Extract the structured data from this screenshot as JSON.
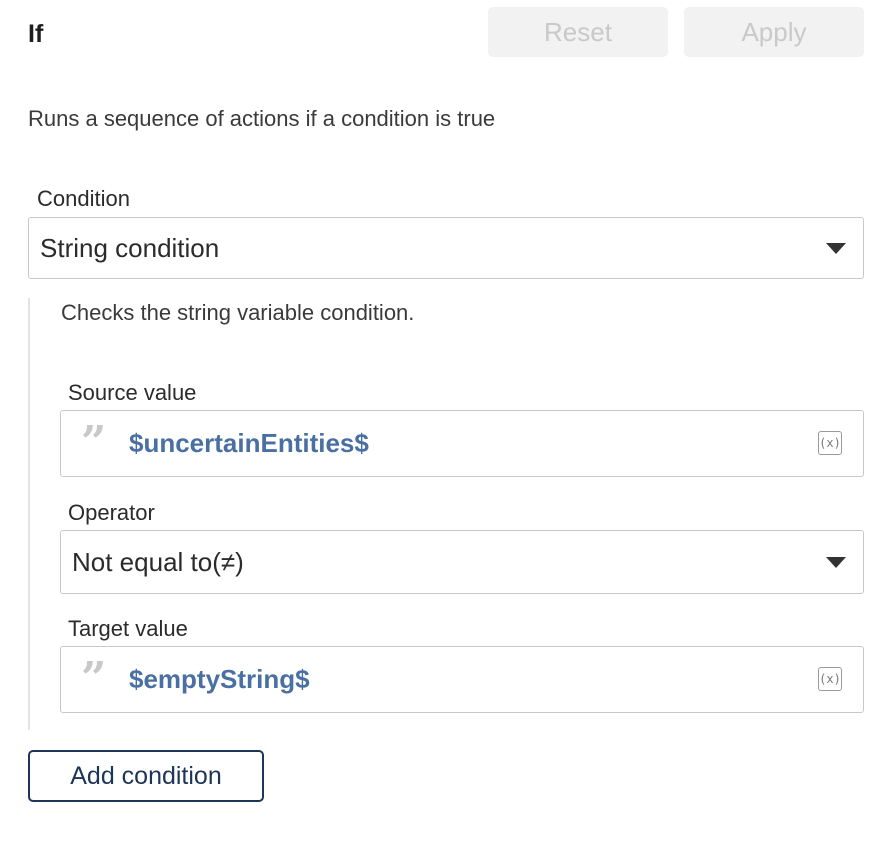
{
  "header": {
    "title": "If",
    "reset_label": "Reset",
    "apply_label": "Apply"
  },
  "description": "Runs a sequence of actions if a condition is true",
  "condition": {
    "label": "Condition",
    "selected": "String condition",
    "help": "Checks the string variable condition."
  },
  "source": {
    "label": "Source value",
    "value": "$uncertainEntities$",
    "clear_icon": "(x)"
  },
  "operator": {
    "label": "Operator",
    "selected": "Not equal to(≠)"
  },
  "target": {
    "label": "Target value",
    "value": "$emptyString$",
    "clear_icon": "(x)"
  },
  "add_condition_label": "Add condition",
  "colors": {
    "variable": "#4a6fa3",
    "add_button_border": "#1d3557",
    "disabled_button_bg": "#f2f2f2"
  }
}
